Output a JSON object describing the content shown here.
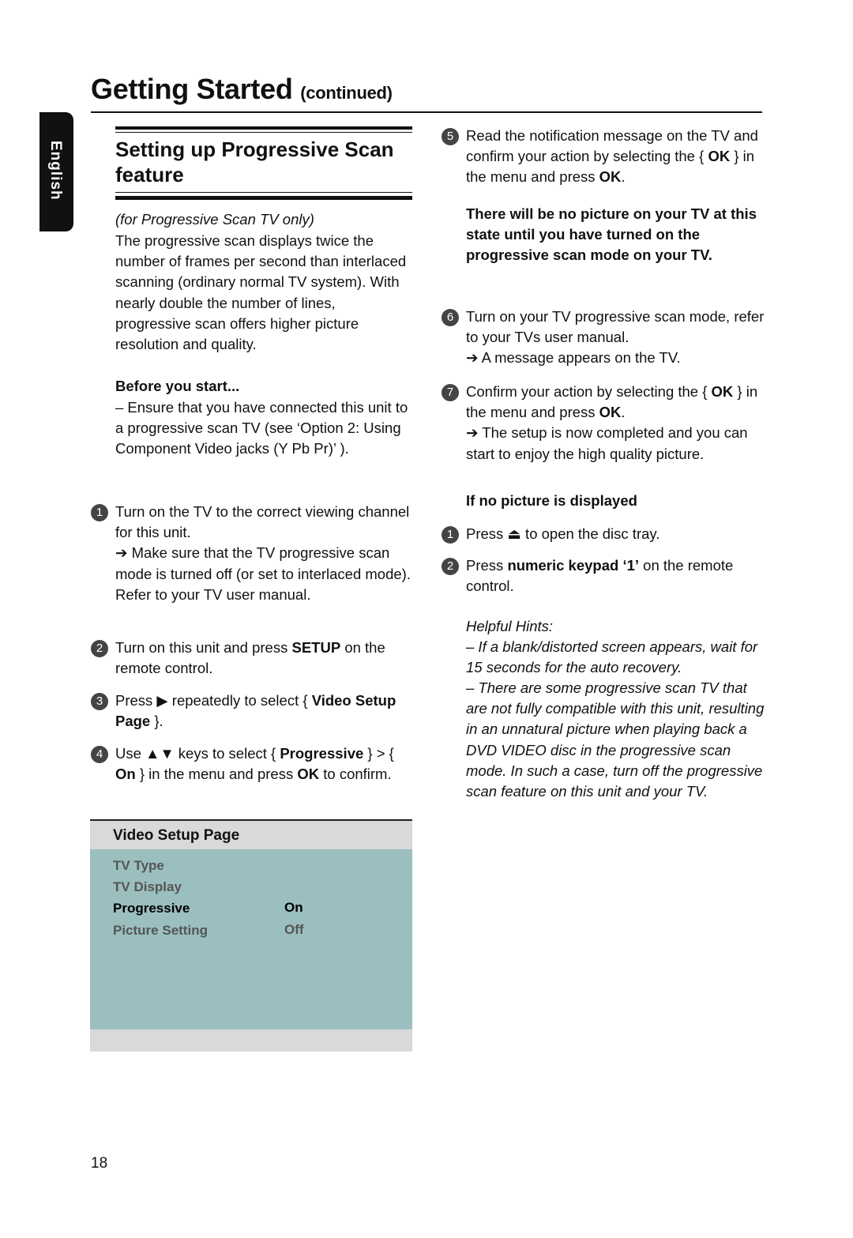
{
  "header": {
    "title": "Getting Started",
    "title_suffix": "(continued)"
  },
  "language_tab": "English",
  "section_title": "Setting up Progressive Scan feature",
  "left": {
    "note": "(for Progressive Scan TV only)",
    "intro": "The progressive scan displays twice the number of frames per second than interlaced scanning (ordinary normal TV system). With nearly double the number of lines, progressive scan offers higher picture resolution and quality.",
    "before_heading": "Before you start...",
    "before_text": "–  Ensure that you have connected this unit to a progressive scan TV (see ‘Option 2: Using Component Video jacks (Y Pb Pr)’ ).",
    "steps": [
      {
        "num": "1",
        "segs": [
          {
            "t": "Turn on the TV to the correct viewing channel for this unit."
          },
          {
            "t": "\n➔ Make sure that the TV progressive scan mode is turned off (or set to interlaced mode). Refer to your TV user manual."
          }
        ]
      },
      {
        "num": "2",
        "segs": [
          {
            "t": "Turn on this unit and press "
          },
          {
            "t": "SETUP",
            "b": true
          },
          {
            "t": " on the remote control."
          }
        ]
      },
      {
        "num": "3",
        "segs": [
          {
            "t": "Press ▶ repeatedly to select { "
          },
          {
            "t": "Video Setup Page",
            "b": true
          },
          {
            "t": " }."
          }
        ]
      },
      {
        "num": "4",
        "segs": [
          {
            "t": "Use ▲▼ keys to select { "
          },
          {
            "t": "Progressive",
            "b": true
          },
          {
            "t": " } > { "
          },
          {
            "t": "On",
            "b": true
          },
          {
            "t": " } in the menu and press "
          },
          {
            "t": "OK",
            "b": true
          },
          {
            "t": " to confirm."
          }
        ]
      }
    ]
  },
  "menu": {
    "title": "Video Setup Page",
    "items": [
      {
        "label": "TV Type",
        "value": ""
      },
      {
        "label": "TV Display",
        "value": ""
      },
      {
        "label": "Progressive",
        "value": "On"
      },
      {
        "label": "Picture Setting",
        "value": "Off"
      }
    ],
    "colors": {
      "header": "#d9d9d9",
      "body": "#9bbfbf"
    }
  },
  "right": {
    "step5": {
      "num": "5",
      "segs": [
        {
          "t": "Read the notification message on the TV and confirm your action by selecting the { "
        },
        {
          "t": "OK",
          "b": true
        },
        {
          "t": " } in the menu and press "
        },
        {
          "t": "OK",
          "b": true
        },
        {
          "t": "."
        }
      ]
    },
    "warning": "There will be no picture on your TV at this state until you have turned on the progressive scan mode on your TV.",
    "step6": {
      "num": "6",
      "segs": [
        {
          "t": "Turn on your TV progressive scan mode, refer to your TVs user manual.\n➔ A message appears on the TV."
        }
      ]
    },
    "step7": {
      "num": "7",
      "segs": [
        {
          "t": "Confirm your action by selecting the { "
        },
        {
          "t": "OK",
          "b": true
        },
        {
          "t": " } in the menu and press "
        },
        {
          "t": "OK",
          "b": true
        },
        {
          "t": ".\n➔ The setup is now completed and you can start to enjoy the high quality picture."
        }
      ]
    },
    "no_picture_heading": "If no picture is displayed",
    "np1": {
      "num": "1",
      "segs": [
        {
          "t": "Press ⏏ to open the disc tray."
        }
      ]
    },
    "np2": {
      "num": "2",
      "segs": [
        {
          "t": "Press "
        },
        {
          "t": "numeric keypad ‘1’",
          "b": true
        },
        {
          "t": " on the remote control."
        }
      ]
    },
    "hints_heading": "Helpful Hints:",
    "hints": [
      "–  If a blank/distorted screen appears, wait for 15 seconds for the auto recovery.",
      "–  There are some progressive scan TV that are not fully compatible with this unit, resulting in an unnatural picture when playing back a DVD VIDEO disc in the progressive scan mode. In such a case, turn off the progressive scan feature on this unit and your TV."
    ]
  },
  "page_number": "18"
}
